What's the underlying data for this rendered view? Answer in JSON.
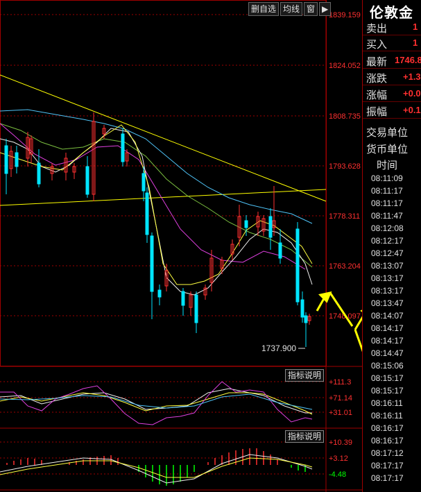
{
  "toolbar": {
    "delete_watch": "删自选",
    "ma_line": "均线",
    "window": "窗",
    "arrow": "▶"
  },
  "axis": {
    "price_ticks": [
      "1839.159",
      "1824.052",
      "1808.735",
      "1793.628",
      "1778.311",
      "1763.204",
      "1748.097"
    ],
    "low_label": "1737.900"
  },
  "indicator1": {
    "button": "指标说明",
    "ticks": [
      "+111.3",
      "+71.14",
      "+31.01"
    ]
  },
  "indicator2": {
    "button": "指标说明",
    "ticks": [
      "+10.39",
      "+3.12",
      "-4.48"
    ]
  },
  "quote": {
    "title": "伦敦金",
    "rows": [
      {
        "label": "卖出",
        "value": "1"
      },
      {
        "label": "买入",
        "value": "1"
      },
      {
        "label": "最新",
        "value": "1746.8"
      },
      {
        "label": "涨跌",
        "value": "+1.3"
      },
      {
        "label": "涨幅",
        "value": "+0.0"
      },
      {
        "label": "振幅",
        "value": "+0.1"
      }
    ],
    "trade_unit": "交易单位",
    "currency_unit": "货币单位",
    "time_header": "时间",
    "times": [
      "08:11:09",
      "08:11:17",
      "08:11:17",
      "08:11:47",
      "08:12:08",
      "08:12:17",
      "08:12:47",
      "08:13:07",
      "08:13:17",
      "08:13:17",
      "08:13:47",
      "08:14:07",
      "08:14:17",
      "08:14:17",
      "08:14:47",
      "08:15:06",
      "08:15:17",
      "08:15:17",
      "08:16:11",
      "08:16:11",
      "08:16:17",
      "08:16:17",
      "08:17:12",
      "08:17:17",
      "08:17:17"
    ]
  },
  "colors": {
    "up": "#ff3030",
    "down": "#00e5ff",
    "annotation": "#ffff00",
    "grid": "#a00000",
    "price_text": "#ff3030"
  }
}
